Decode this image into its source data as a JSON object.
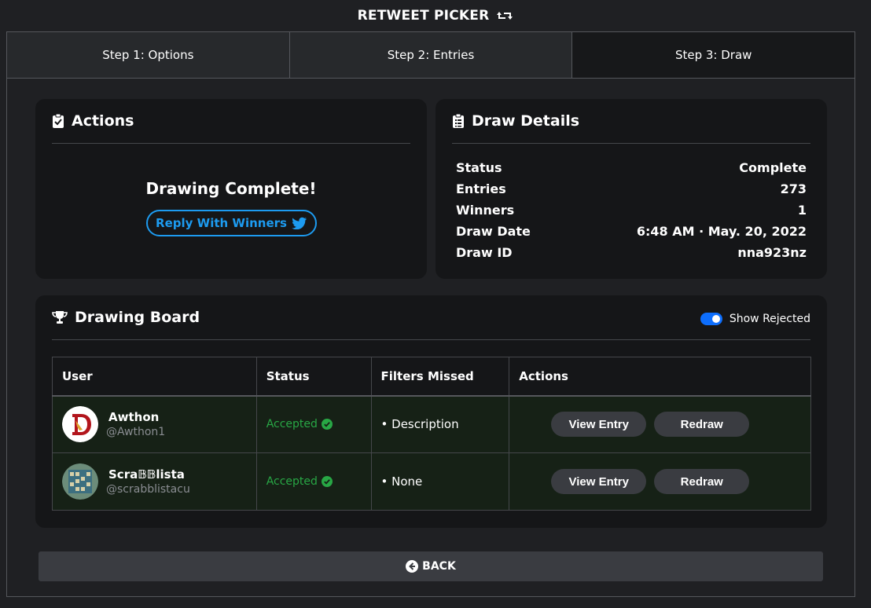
{
  "app": {
    "title": "RETWEET PICKER"
  },
  "tabs": [
    {
      "label": "Step 1: Options"
    },
    {
      "label": "Step 2: Entries"
    },
    {
      "label": "Step 3: Draw"
    }
  ],
  "actions_card": {
    "title": "Actions",
    "message": "Drawing Complete!",
    "reply_button": "Reply With Winners"
  },
  "details_card": {
    "title": "Draw Details",
    "rows": [
      {
        "label": "Status",
        "value": "Complete"
      },
      {
        "label": "Entries",
        "value": "273"
      },
      {
        "label": "Winners",
        "value": "1"
      },
      {
        "label": "Draw Date",
        "value": "6:48 AM · May. 20, 2022"
      },
      {
        "label": "Draw ID",
        "value": "nna923nz"
      }
    ]
  },
  "board": {
    "title": "Drawing Board",
    "toggle_label": "Show Rejected",
    "toggle_on": true,
    "columns": [
      "User",
      "Status",
      "Filters Missed",
      "Actions"
    ],
    "rows": [
      {
        "name": "Awthon",
        "handle": "@Awthon1",
        "status": "Accepted",
        "filters": "• Description",
        "view_label": "View Entry",
        "redraw_label": "Redraw"
      },
      {
        "name": "Scra𝔹𝔹lista",
        "handle": "@scrabblistacu",
        "status": "Accepted",
        "filters": "• None",
        "view_label": "View Entry",
        "redraw_label": "Redraw"
      }
    ]
  },
  "back_button": "BACK",
  "colors": {
    "accent": "#0d6efd",
    "twitter": "#1d9bf0",
    "success": "#28a745",
    "row_bg": "#162116"
  }
}
